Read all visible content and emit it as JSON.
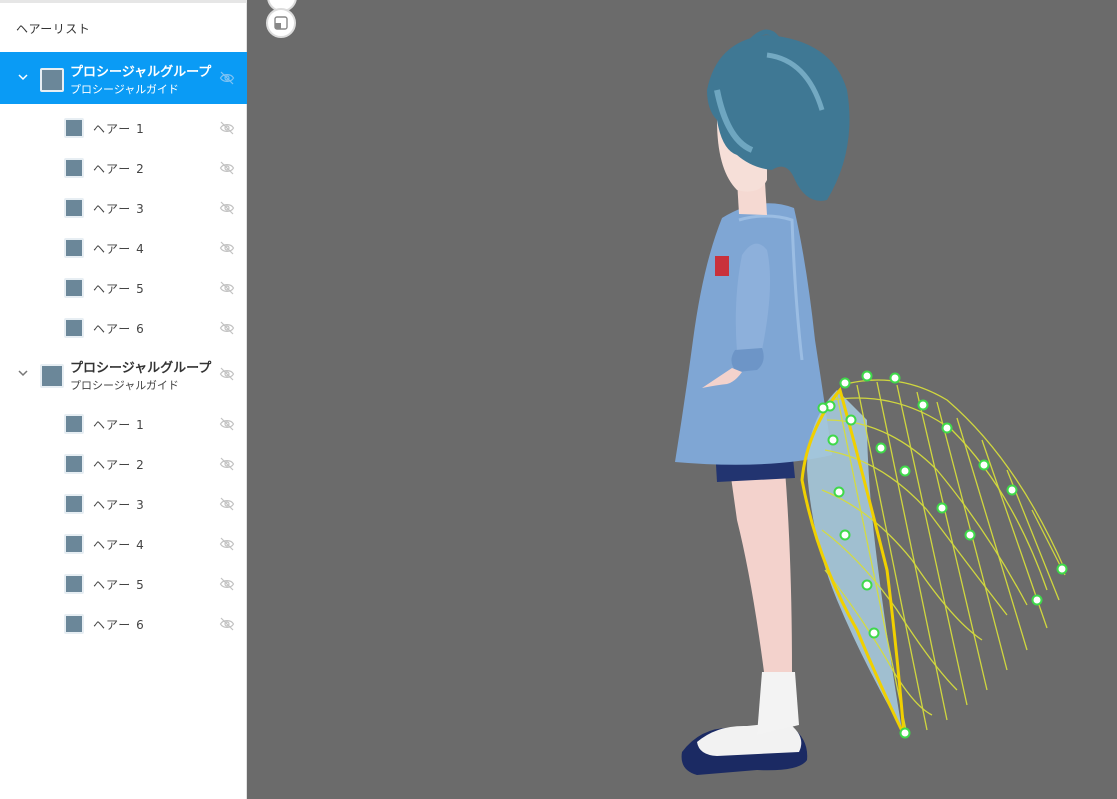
{
  "sidebar": {
    "title": "ヘアーリスト",
    "groups": [
      {
        "title": "プロシージャルグループ",
        "subtitle": "プロシージャルガイド",
        "selected": true,
        "children": [
          "ヘアー 1",
          "ヘアー 2",
          "ヘアー 3",
          "ヘアー 4",
          "ヘアー 5",
          "ヘアー 6"
        ]
      },
      {
        "title": "プロシージャルグループ",
        "subtitle": "プロシージャルガイド",
        "selected": false,
        "children": [
          "ヘアー 1",
          "ヘアー 2",
          "ヘアー 3",
          "ヘアー 4",
          "ヘアー 5",
          "ヘアー 6"
        ]
      }
    ]
  },
  "icons": {
    "expand": "chevron-down-icon",
    "visibility": "eye-off-icon",
    "viewport_button": "expand-view-icon"
  },
  "colors": {
    "selected_row": "#0a9bf5",
    "swatch": "#6b8799",
    "viewport_bg": "#6b6b6b",
    "guide_mesh": "#d6dd3c",
    "guide_points": "#3fd94a"
  }
}
